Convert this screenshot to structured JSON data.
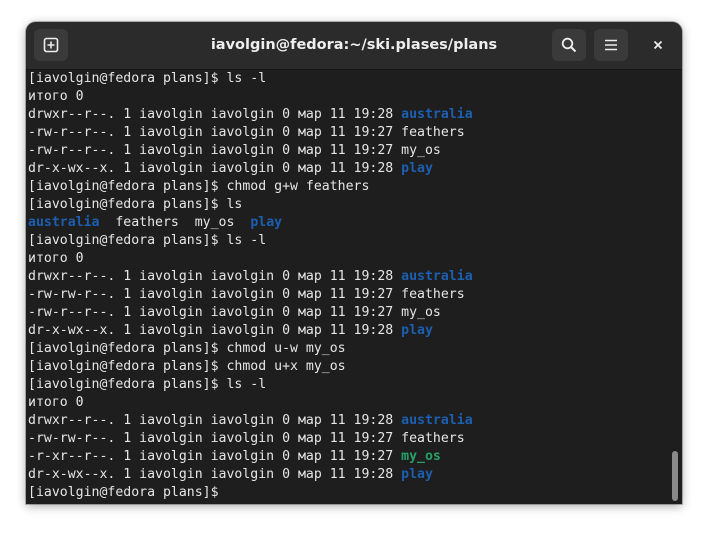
{
  "window": {
    "title": "iavolgin@fedora:~/ski.plases/plans"
  },
  "icons": {
    "new_tab": "new-tab-icon",
    "search": "search-icon",
    "menu": "hamburger-menu-icon",
    "close": "close-icon"
  },
  "colors": {
    "terminal_bg": "#1e1e1e",
    "text": "#e6e6e6",
    "directory": "#1c5fb0",
    "executable": "#26a269"
  },
  "terminal": {
    "lines": [
      [
        {
          "t": "[iavolgin@fedora plans]$ ls -l"
        }
      ],
      [
        {
          "t": "итого 0"
        }
      ],
      [
        {
          "t": "drwxr--r--. 1 iavolgin iavolgin 0 мар 11 19:28 "
        },
        {
          "t": "australia",
          "c": "dir"
        }
      ],
      [
        {
          "t": "-rw-r--r--. 1 iavolgin iavolgin 0 мар 11 19:27 feathers"
        }
      ],
      [
        {
          "t": "-rw-r--r--. 1 iavolgin iavolgin 0 мар 11 19:27 my_os"
        }
      ],
      [
        {
          "t": "dr-x-wx--x. 1 iavolgin iavolgin 0 мар 11 19:28 "
        },
        {
          "t": "play",
          "c": "dir"
        }
      ],
      [
        {
          "t": "[iavolgin@fedora plans]$ chmod g+w feathers"
        }
      ],
      [
        {
          "t": "[iavolgin@fedora plans]$ ls"
        }
      ],
      [
        {
          "t": "australia",
          "c": "dir"
        },
        {
          "t": "  feathers  my_os  "
        },
        {
          "t": "play",
          "c": "dir"
        }
      ],
      [
        {
          "t": "[iavolgin@fedora plans]$ ls -l"
        }
      ],
      [
        {
          "t": "итого 0"
        }
      ],
      [
        {
          "t": "drwxr--r--. 1 iavolgin iavolgin 0 мар 11 19:28 "
        },
        {
          "t": "australia",
          "c": "dir"
        }
      ],
      [
        {
          "t": "-rw-rw-r--. 1 iavolgin iavolgin 0 мар 11 19:27 feathers"
        }
      ],
      [
        {
          "t": "-rw-r--r--. 1 iavolgin iavolgin 0 мар 11 19:27 my_os"
        }
      ],
      [
        {
          "t": "dr-x-wx--x. 1 iavolgin iavolgin 0 мар 11 19:28 "
        },
        {
          "t": "play",
          "c": "dir"
        }
      ],
      [
        {
          "t": "[iavolgin@fedora plans]$ chmod u-w my_os"
        }
      ],
      [
        {
          "t": "[iavolgin@fedora plans]$ chmod u+x my_os"
        }
      ],
      [
        {
          "t": "[iavolgin@fedora plans]$ ls -l"
        }
      ],
      [
        {
          "t": "итого 0"
        }
      ],
      [
        {
          "t": "drwxr--r--. 1 iavolgin iavolgin 0 мар 11 19:28 "
        },
        {
          "t": "australia",
          "c": "dir"
        }
      ],
      [
        {
          "t": "-rw-rw-r--. 1 iavolgin iavolgin 0 мар 11 19:27 feathers"
        }
      ],
      [
        {
          "t": "-r-xr--r--. 1 iavolgin iavolgin 0 мар 11 19:27 "
        },
        {
          "t": "my_os",
          "c": "exe"
        }
      ],
      [
        {
          "t": "dr-x-wx--x. 1 iavolgin iavolgin 0 мар 11 19:28 "
        },
        {
          "t": "play",
          "c": "dir"
        }
      ],
      [
        {
          "t": "[iavolgin@fedora plans]$ "
        }
      ]
    ]
  }
}
